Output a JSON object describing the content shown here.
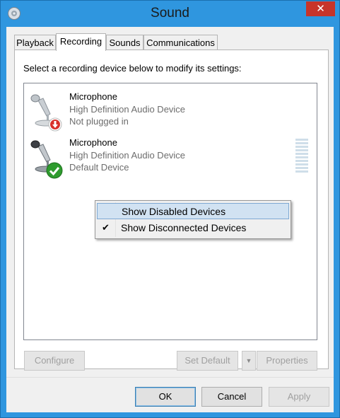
{
  "window": {
    "title": "Sound",
    "close_glyph": "✕",
    "accent": "#2f96df",
    "close_color": "#c7342a"
  },
  "tabs": [
    {
      "label": "Playback",
      "active": false
    },
    {
      "label": "Recording",
      "active": true
    },
    {
      "label": "Sounds",
      "active": false
    },
    {
      "label": "Communications",
      "active": false
    }
  ],
  "recording": {
    "instruction": "Select a recording device below to modify its settings:",
    "devices": [
      {
        "name": "Microphone",
        "description": "High Definition Audio Device",
        "status": "Not plugged in",
        "icon": "microphone-icon",
        "badge": "unplugged-badge-icon",
        "badge_color": "#d8302b"
      },
      {
        "name": "Microphone",
        "description": "High Definition Audio Device",
        "status": "Default Device",
        "icon": "microphone-icon",
        "badge": "default-check-badge-icon",
        "badge_color": "#2e9b2e"
      }
    ]
  },
  "context_menu": {
    "items": [
      {
        "label": "Show Disabled Devices",
        "checked": false,
        "highlighted": true
      },
      {
        "label": "Show Disconnected Devices",
        "checked": true,
        "highlighted": false
      }
    ],
    "check_glyph": "✔"
  },
  "panel_buttons": {
    "configure": "Configure",
    "set_default": "Set Default",
    "dropdown_glyph": "▼",
    "properties": "Properties"
  },
  "dialog_buttons": {
    "ok": "OK",
    "cancel": "Cancel",
    "apply": "Apply"
  }
}
